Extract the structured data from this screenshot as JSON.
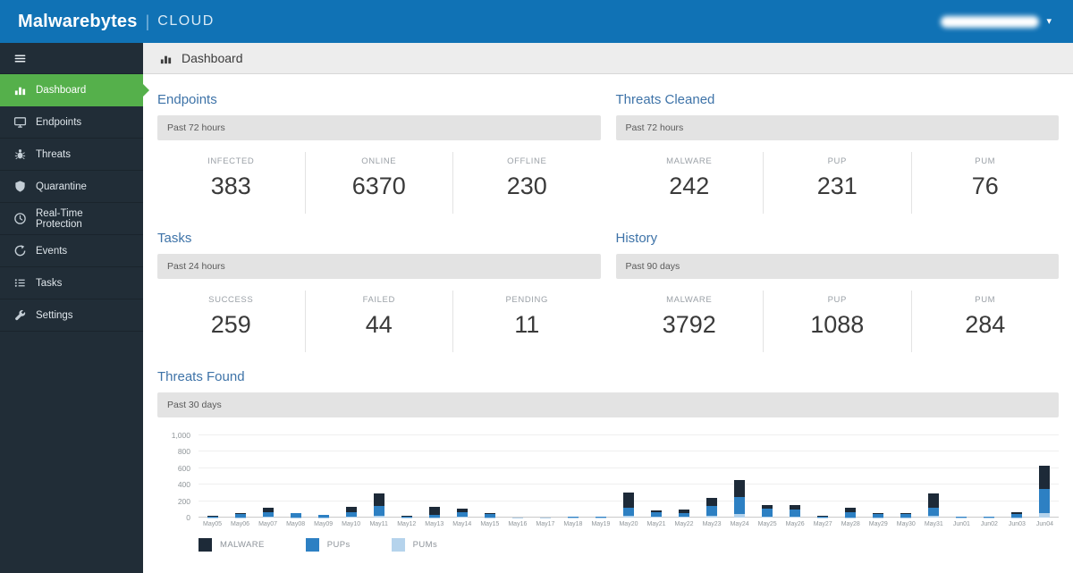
{
  "topbar": {
    "brand_bold": "Malwarebytes",
    "brand_sep": "|",
    "brand_light": "CLOUD"
  },
  "colors": {
    "topbar_blue": "#1072b5",
    "sidebar_dark": "#212d37",
    "active_green": "#55b04b",
    "title_blue": "#3e73a8"
  },
  "sidebar": {
    "items": [
      {
        "label": "Dashboard",
        "icon": "dashboard-icon",
        "active": true
      },
      {
        "label": "Endpoints",
        "icon": "endpoints-icon",
        "active": false
      },
      {
        "label": "Threats",
        "icon": "threats-icon",
        "active": false
      },
      {
        "label": "Quarantine",
        "icon": "quarantine-icon",
        "active": false
      },
      {
        "label": "Real-Time Protection",
        "icon": "realtime-icon",
        "active": false
      },
      {
        "label": "Events",
        "icon": "events-icon",
        "active": false
      },
      {
        "label": "Tasks",
        "icon": "tasks-icon",
        "active": false
      },
      {
        "label": "Settings",
        "icon": "settings-icon",
        "active": false
      }
    ]
  },
  "header": {
    "title": "Dashboard",
    "icon": "dashboard-icon"
  },
  "panels": [
    {
      "title": "Endpoints",
      "range": "Past 72 hours",
      "stats": [
        {
          "label": "INFECTED",
          "value": "383"
        },
        {
          "label": "ONLINE",
          "value": "6370"
        },
        {
          "label": "OFFLINE",
          "value": "230"
        }
      ]
    },
    {
      "title": "Threats Cleaned",
      "range": "Past 72 hours",
      "stats": [
        {
          "label": "MALWARE",
          "value": "242"
        },
        {
          "label": "PUP",
          "value": "231"
        },
        {
          "label": "PUM",
          "value": "76"
        }
      ]
    },
    {
      "title": "Tasks",
      "range": "Past 24 hours",
      "stats": [
        {
          "label": "SUCCESS",
          "value": "259"
        },
        {
          "label": "FAILED",
          "value": "44"
        },
        {
          "label": "PENDING",
          "value": "11"
        }
      ]
    },
    {
      "title": "History",
      "range": "Past 90 days",
      "stats": [
        {
          "label": "MALWARE",
          "value": "3792"
        },
        {
          "label": "PUP",
          "value": "1088"
        },
        {
          "label": "PUM",
          "value": "284"
        }
      ]
    }
  ],
  "threats_found": {
    "title": "Threats Found",
    "range": "Past 30 days"
  },
  "chart_data": {
    "type": "bar",
    "stacked": true,
    "title": "Threats Found",
    "xlabel": "",
    "ylabel": "",
    "ylim": [
      0,
      1000
    ],
    "yticks": [
      0,
      200,
      400,
      600,
      800,
      1000
    ],
    "ytick_labels": [
      "0",
      "200",
      "400",
      "600",
      "800",
      "1,000"
    ],
    "grid": true,
    "legend_position": "bottom",
    "legend": [
      "MALWARE",
      "PUPs",
      "PUMs"
    ],
    "categories": [
      "May05",
      "May06",
      "May07",
      "May08",
      "May09",
      "May10",
      "May11",
      "May12",
      "May13",
      "May14",
      "May15",
      "May16",
      "May17",
      "May18",
      "May19",
      "May20",
      "May21",
      "May22",
      "May23",
      "May24",
      "May25",
      "May26",
      "May27",
      "May28",
      "May29",
      "May30",
      "May31",
      "Jun01",
      "Jun02",
      "Jun03",
      "Jun04"
    ],
    "series": [
      {
        "name": "MALWARE",
        "color": "#1d2a38",
        "values": [
          10,
          15,
          50,
          10,
          5,
          60,
          145,
          5,
          95,
          45,
          5,
          2,
          2,
          5,
          5,
          180,
          20,
          40,
          100,
          215,
          50,
          60,
          10,
          55,
          20,
          15,
          170,
          5,
          5,
          25,
          280
        ]
      },
      {
        "name": "PUPs",
        "color": "#2d80c3",
        "values": [
          10,
          40,
          55,
          45,
          25,
          60,
          120,
          10,
          30,
          55,
          40,
          2,
          2,
          8,
          8,
          95,
          55,
          50,
          120,
          205,
          90,
          85,
          12,
          60,
          35,
          35,
          100,
          8,
          8,
          40,
          300
        ]
      },
      {
        "name": "PUMs",
        "color": "#b5d3ec",
        "values": [
          5,
          5,
          10,
          5,
          5,
          10,
          25,
          5,
          5,
          10,
          5,
          1,
          1,
          2,
          2,
          25,
          10,
          10,
          20,
          40,
          15,
          10,
          3,
          5,
          5,
          5,
          20,
          2,
          2,
          5,
          50
        ]
      }
    ]
  }
}
